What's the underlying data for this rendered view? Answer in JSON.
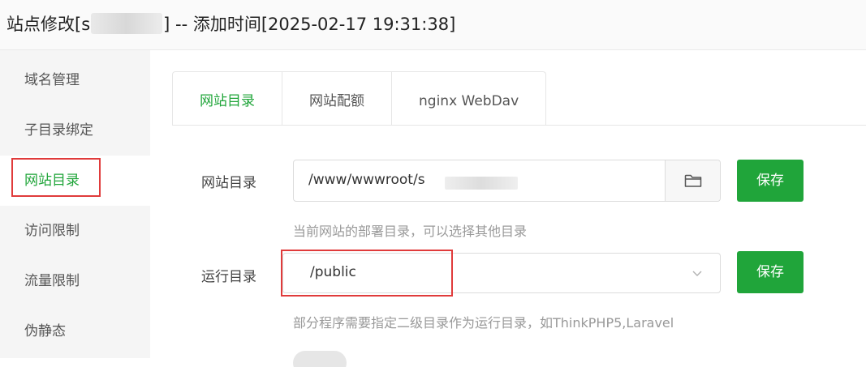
{
  "window": {
    "title_prefix": "站点修改[s",
    "title_suffix": "] -- 添加时间[2025-02-17 19:31:38]"
  },
  "sidebar": {
    "items": [
      {
        "label": "域名管理"
      },
      {
        "label": "子目录绑定"
      },
      {
        "label": "网站目录"
      },
      {
        "label": "访问限制"
      },
      {
        "label": "流量限制"
      },
      {
        "label": "伪静态"
      }
    ],
    "active_item": "网站目录"
  },
  "tabs": [
    {
      "label": "网站目录"
    },
    {
      "label": "网站配额"
    },
    {
      "label": "nginx WebDav"
    }
  ],
  "active_tab": "网站目录",
  "site_dir": {
    "label": "网站目录",
    "value": "/www/wwwroot/s",
    "icon": "folder-icon",
    "save_label": "保存",
    "hint": "当前网站的部署目录，可以选择其他目录"
  },
  "run_dir": {
    "label": "运行目录",
    "value": "/public",
    "icon": "chevron-down-icon",
    "save_label": "保存",
    "hint": "部分程序需要指定二级目录作为运行目录，如ThinkPHP5,Laravel"
  },
  "colors": {
    "accent": "#20a53a",
    "highlight": "#e03b3b"
  }
}
